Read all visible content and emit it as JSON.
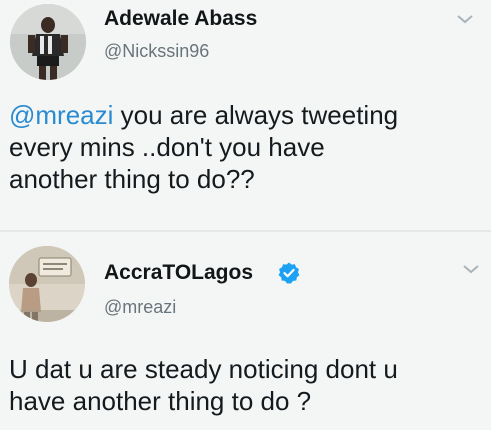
{
  "tweets": [
    {
      "name": "Adewale Abass",
      "handle": "@Nickssin96",
      "verified": false,
      "text_lines": [
        {
          "mention": "@mreazi",
          "rest": " you are always tweeting"
        },
        {
          "mention": "",
          "rest": "every mins ..don't you have"
        },
        {
          "mention": "",
          "rest": "another thing to do??"
        }
      ]
    },
    {
      "name": "AccraTOLagos",
      "handle": "@mreazi",
      "verified": true,
      "text_lines": [
        {
          "mention": "",
          "rest": "U dat u are steady noticing dont u"
        },
        {
          "mention": "",
          "rest": "have another thing to do ?"
        }
      ]
    }
  ],
  "icons": {
    "chevron": "chevron-down-icon",
    "verified": "verified-badge-icon"
  },
  "colors": {
    "mention": "#2a8bd1",
    "handle": "#68757c",
    "verified": "#1da1f2"
  }
}
